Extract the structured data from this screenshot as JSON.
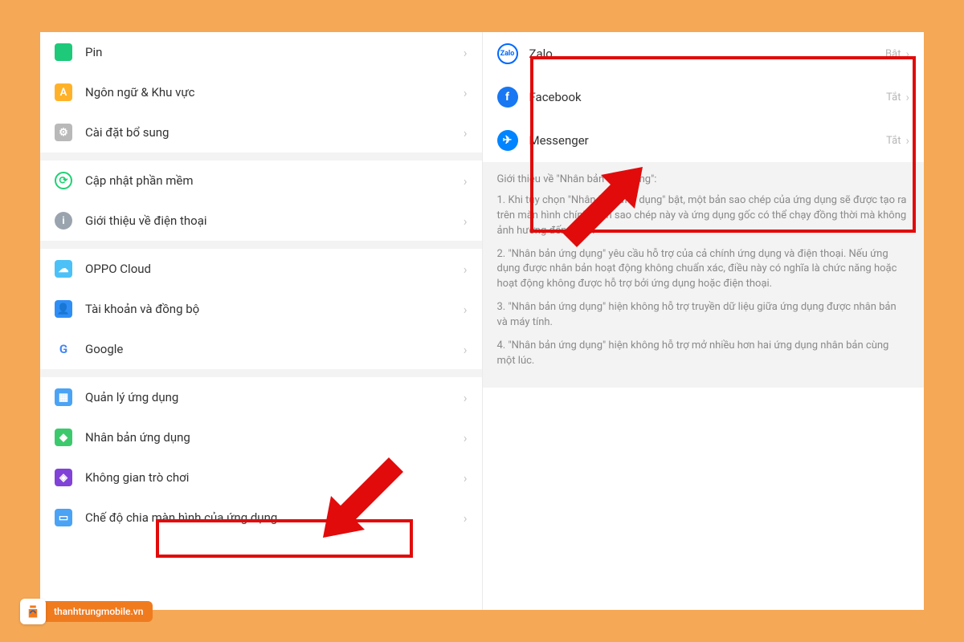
{
  "settings": {
    "items": [
      {
        "label": "Pin",
        "icon": "icon-pin"
      },
      {
        "label": "Ngôn ngữ & Khu vực",
        "icon": "icon-lang"
      },
      {
        "label": "Cài đặt bổ sung",
        "icon": "icon-addl"
      }
    ],
    "group2": [
      {
        "label": "Cập nhật phần mềm",
        "icon": "icon-update",
        "glyph": "⟳"
      },
      {
        "label": "Giới thiệu về điện thoại",
        "icon": "icon-about",
        "glyph": "i"
      }
    ],
    "group3": [
      {
        "label": "OPPO Cloud",
        "icon": "icon-cloud",
        "glyph": "☁"
      },
      {
        "label": "Tài khoản và đồng bộ",
        "icon": "icon-account",
        "glyph": "👤"
      },
      {
        "label": "Google",
        "icon": "icon-google",
        "glyph": "G"
      }
    ],
    "group4": [
      {
        "label": "Quản lý ứng dụng",
        "icon": "icon-apps",
        "glyph": "▦"
      },
      {
        "label": "Nhân bản ứng dụng",
        "icon": "icon-clone",
        "glyph": "◆"
      },
      {
        "label": "Không gian trò chơi",
        "icon": "icon-game",
        "glyph": "◈"
      },
      {
        "label": "Chế độ chia màn hình của ứng dụng",
        "icon": "icon-split",
        "glyph": "▭"
      }
    ]
  },
  "apps": [
    {
      "name": "Zalo",
      "state": "Bật",
      "iconClass": "zalo",
      "glyph": "Zalo"
    },
    {
      "name": "Facebook",
      "state": "Tắt",
      "iconClass": "fb",
      "glyph": "f"
    },
    {
      "name": "Messenger",
      "state": "Tắt",
      "iconClass": "msg",
      "glyph": "✈"
    }
  ],
  "info": {
    "title": "Giới thiệu về \"Nhân bản ứng dụng\":",
    "p1": "1. Khi tùy chọn \"Nhân bản ứng dụng\" bật, một bản sao chép của ứng dụng sẽ được tạo ra trên màn hình chính. Bản sao chép này và ứng dụng gốc có thể chạy đồng thời mà không ảnh hưởng đến nhau.",
    "p2": "2. \"Nhân bản ứng dụng\" yêu cầu hỗ trợ của cả chính ứng dụng và điện thoại. Nếu ứng dụng được nhân bản hoạt động không chuẩn xác, điều này có nghĩa là chức năng hoặc hoạt động không được hỗ trợ bởi ứng dụng hoặc điện thoại.",
    "p3": "3. \"Nhân bản ứng dụng\" hiện không hỗ trợ truyền dữ liệu giữa ứng dụng được nhân bản và máy tính.",
    "p4": "4. \"Nhân bản ứng dụng\" hiện không hỗ trợ mở nhiều hơn hai ứng dụng nhân bản cùng một lúc."
  },
  "badge": {
    "text": "thanhtrungmobile.vn"
  }
}
